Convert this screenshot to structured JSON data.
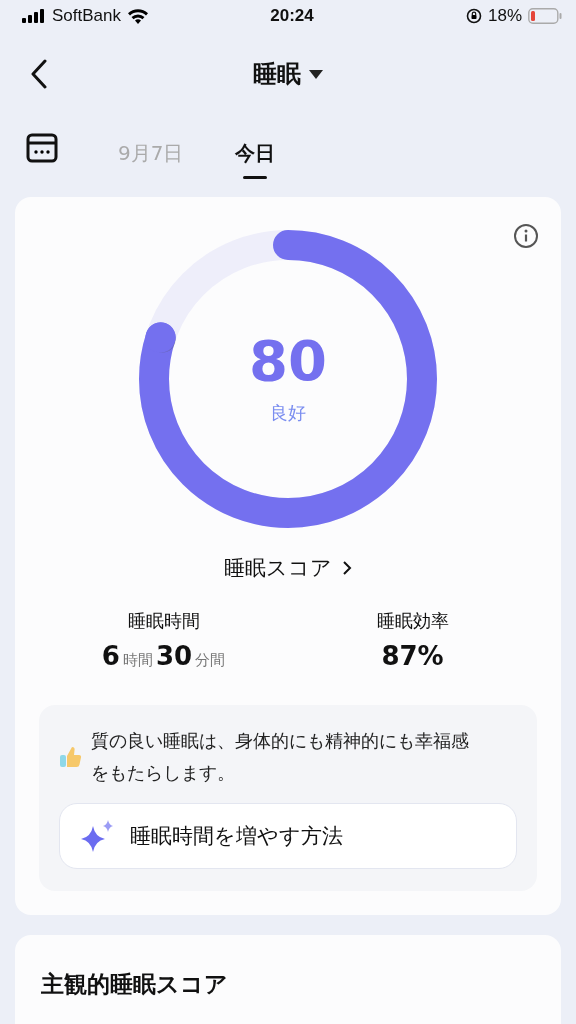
{
  "status_bar": {
    "carrier": "SoftBank",
    "time": "20:24",
    "battery": "18%"
  },
  "header": {
    "title": "睡眠"
  },
  "date_tabs": [
    {
      "label": "9月7日",
      "selected": false
    },
    {
      "label": "今日",
      "selected": true
    }
  ],
  "score_card": {
    "score": "80",
    "rating": "良好",
    "link": "睡眠スコア",
    "stats": [
      {
        "label": "睡眠時間",
        "value_parts": [
          {
            "kind": "number",
            "text": "6"
          },
          {
            "kind": "unit",
            "text": "時間"
          },
          {
            "kind": "number",
            "text": "30"
          },
          {
            "kind": "unit",
            "text": "分間"
          }
        ]
      },
      {
        "label": "睡眠効率",
        "value_parts": [
          {
            "kind": "number",
            "text": "87%"
          }
        ]
      }
    ],
    "tip": "質の良い睡眠は、身体的にも精神的にも幸福感をもたらします。",
    "tip_button": "睡眠時間を増やす方法"
  },
  "subjective_card": {
    "title": "主観的睡眠スコア"
  }
}
